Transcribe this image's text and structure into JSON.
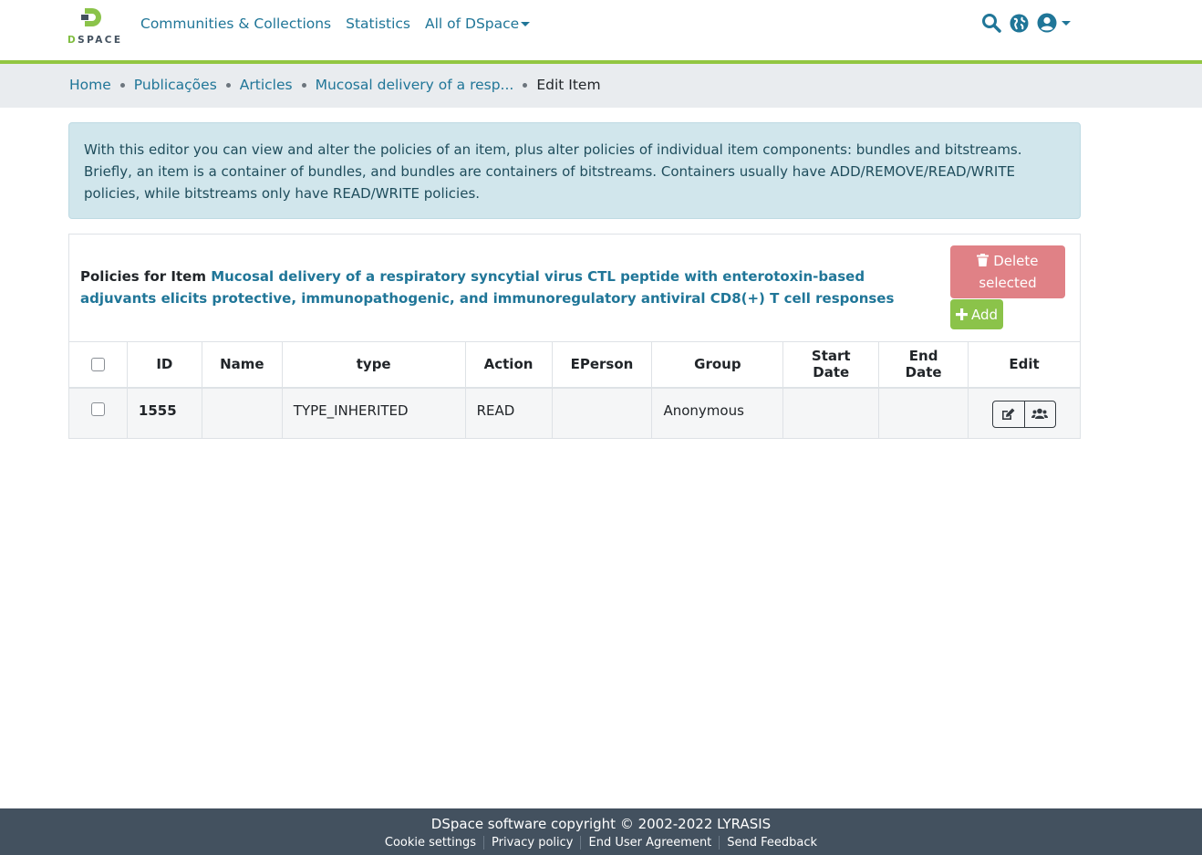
{
  "brand": {
    "logo_text_accent": "D",
    "logo_text_rest": "SPACE"
  },
  "nav": {
    "items": [
      "Communities & Collections",
      "Statistics",
      "All of DSpace"
    ]
  },
  "header_icons": [
    "search-icon",
    "globe-icon",
    "user-icon"
  ],
  "breadcrumb": {
    "items": [
      "Home",
      "Publicações",
      "Articles",
      "Mucosal delivery of a resp..."
    ],
    "current": "Edit Item"
  },
  "alert": {
    "text": "With this editor you can view and alter the policies of an item, plus alter policies of individual item components: bundles and bitstreams. Briefly, an item is a container of bundles, and bundles are containers of bitstreams. Containers usually have ADD/REMOVE/READ/WRITE policies, while bitstreams only have READ/WRITE policies."
  },
  "policies": {
    "label": "Policies for Item",
    "item_title": "Mucosal delivery of a respiratory syncytial virus CTL peptide with enterotoxin-based adjuvants elicits protective, immunopathogenic, and immunoregulatory antiviral CD8(+) T cell responses",
    "delete_label_line1": "Delete",
    "delete_label_line2": "selected",
    "add_label": "Add"
  },
  "table": {
    "columns": [
      "ID",
      "Name",
      "type",
      "Action",
      "EPerson",
      "Group",
      "Start Date",
      "End Date",
      "Edit"
    ],
    "rows": [
      {
        "id": "1555",
        "name": "",
        "type": "TYPE_INHERITED",
        "action": "READ",
        "eperson": "",
        "group": "Anonymous",
        "start_date": "",
        "end_date": ""
      }
    ]
  },
  "footer": {
    "copyright": "DSpace software copyright © 2002-2022 LYRASIS",
    "links": [
      "Cookie settings",
      "Privacy policy",
      "End User Agreement",
      "Send Feedback"
    ]
  },
  "colors": {
    "brand_green": "#92c642",
    "link": "#207698",
    "footer_bg": "#43515f",
    "danger_button": "#e08186",
    "success_button": "#8bc34a"
  }
}
